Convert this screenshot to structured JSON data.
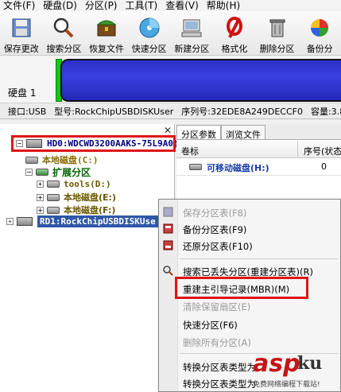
{
  "menu": [
    "文件(F)",
    "硬盘(D)",
    "分区(P)",
    "工具(T)",
    "查看(V)",
    "帮助(H)"
  ],
  "toolbar": [
    {
      "label": "保存更改",
      "icon": "save-icon"
    },
    {
      "label": "搜索分区",
      "icon": "search-icon"
    },
    {
      "label": "恢复文件",
      "icon": "chest-icon"
    },
    {
      "label": "快速分区",
      "icon": "disc-icon"
    },
    {
      "label": "新建分区",
      "icon": "computer-icon"
    },
    {
      "label": "格式化",
      "icon": "format-icon"
    },
    {
      "label": "删除分区",
      "icon": "trash-icon"
    },
    {
      "label": "备份分",
      "icon": "backup-icon"
    }
  ],
  "disk": {
    "label": "硬盘 1"
  },
  "info": {
    "interface": "接口:USB",
    "model": "型号:RockChipUSBDISKUser",
    "serial": "序列号:32EDE8A249DECCF0",
    "capacity": "容量:3.8G"
  },
  "tree": {
    "hd0": "HD0:WDCWD3200AAKS-75L9A0(",
    "local_c": "本地磁盘(C:)",
    "extended": "扩展分区",
    "tools": "tools(D:)",
    "local_e": "本地磁盘(E:)",
    "local_f": "本地磁盘(F:)",
    "rd1": "RD1:RockChipUSBDISKUse"
  },
  "tabs": [
    "分区参数",
    "浏览文件"
  ],
  "columns": {
    "label": "卷标",
    "index": "序号(状态"
  },
  "rows": [
    {
      "name": "可移动磁盘(H:)",
      "index": "0"
    }
  ],
  "context_menu": [
    {
      "label": "保存分区表(F8)",
      "disabled": true
    },
    {
      "label": "备份分区表(F9)",
      "disabled": false
    },
    {
      "label": "还原分区表(F10)",
      "disabled": false
    },
    {
      "label": "搜索已丢失分区(重建分区表)(R)",
      "disabled": false
    },
    {
      "label": "重建主引导记录(MBR)(M)",
      "disabled": false
    },
    {
      "label": "清除保留扇区(E)",
      "disabled": true
    },
    {
      "label": "快速分区(F6)",
      "disabled": false
    },
    {
      "label": "删除所有分区(A)",
      "disabled": true
    },
    {
      "label": "转换分区表类型为",
      "disabled": false
    },
    {
      "label": "转换分区表类型为",
      "disabled": false
    }
  ],
  "watermark": {
    "main": "asp",
    "mark": "ku",
    "sub": "免费网络编程下载站!"
  },
  "colors": {
    "accent_red": "#e01414",
    "disk_blue": "#2b30c8",
    "selection_blue": "#2e57a8"
  }
}
